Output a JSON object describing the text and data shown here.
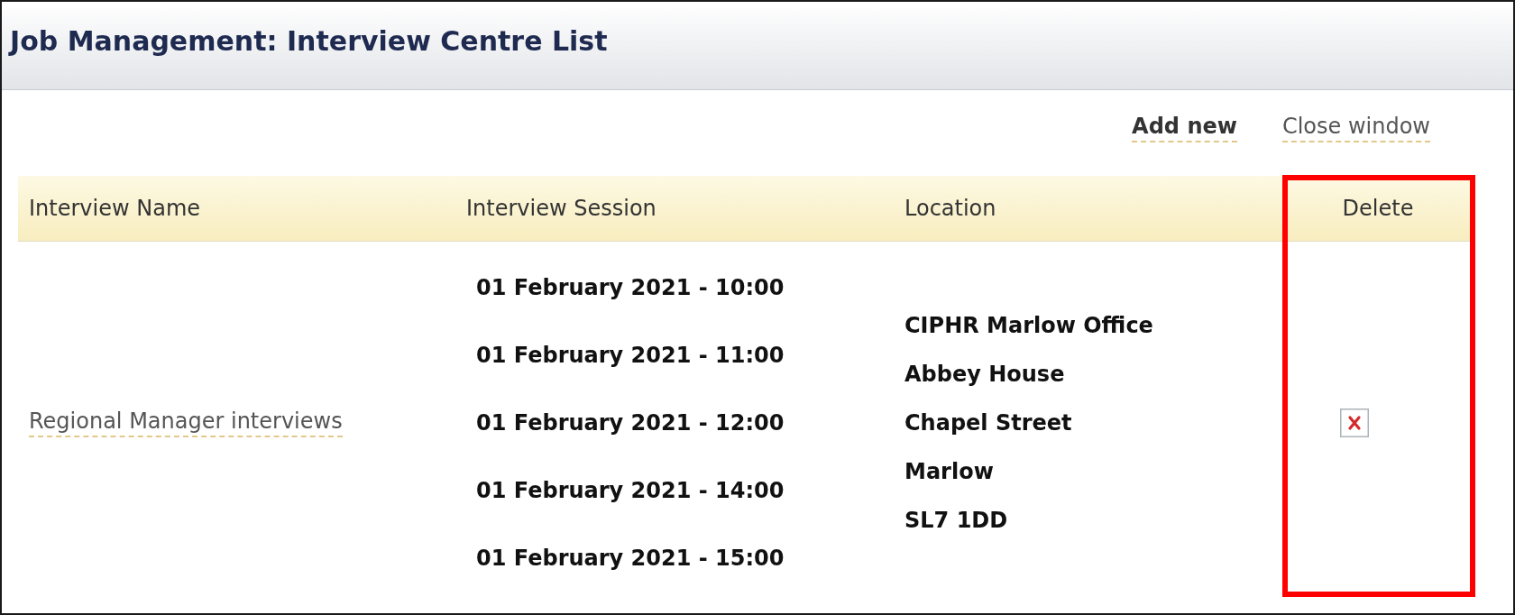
{
  "window": {
    "title": "Job Management: Interview Centre List"
  },
  "actions": [
    {
      "label": "Add new",
      "kind": "add"
    },
    {
      "label": "Close window",
      "kind": "close"
    }
  ],
  "table": {
    "columns": [
      {
        "label": "Interview Name",
        "highlighted": false
      },
      {
        "label": "Interview Session",
        "highlighted": false
      },
      {
        "label": "Location",
        "highlighted": false
      },
      {
        "label": "Delete",
        "highlighted": true
      }
    ],
    "rows": [
      {
        "name": "Regional Manager interviews",
        "sessions": [
          "01 February 2021 - 10:00",
          "01 February 2021 - 11:00",
          "01 February 2021 - 12:00",
          "01 February 2021 - 14:00",
          "01 February 2021 - 15:00"
        ],
        "location": [
          "CIPHR Marlow Office",
          "Abbey House",
          "Chapel Street",
          "Marlow",
          "SL7 1DD"
        ]
      }
    ]
  }
}
